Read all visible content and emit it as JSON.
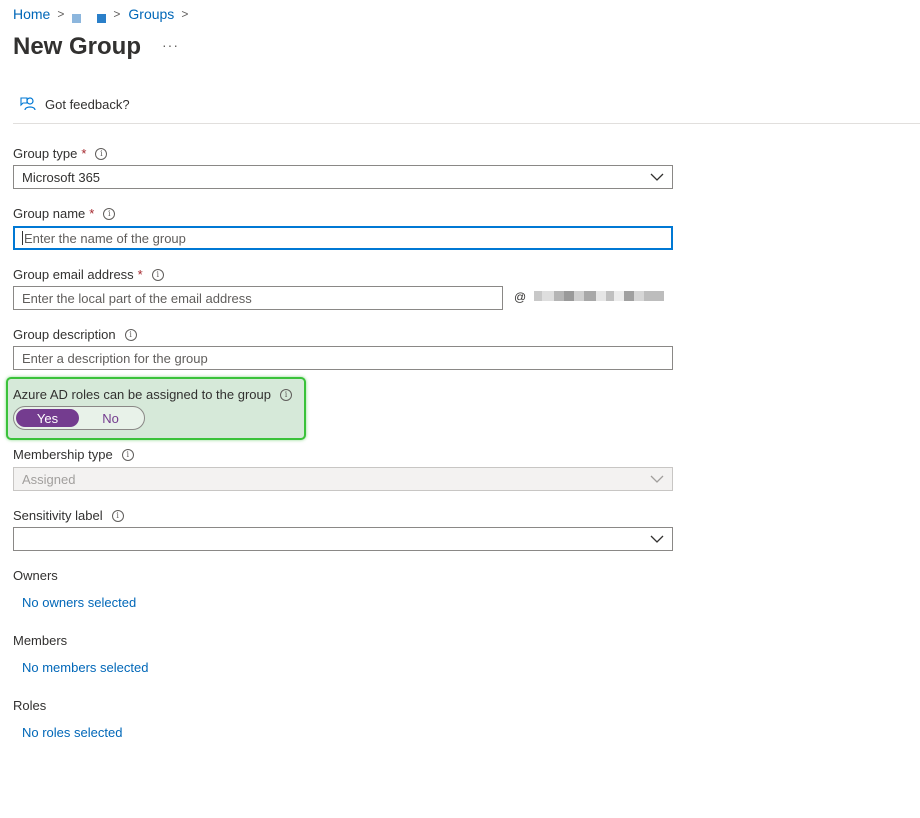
{
  "breadcrumb": {
    "home": "Home",
    "groups": "Groups"
  },
  "page": {
    "title": "New Group",
    "more": "···"
  },
  "feedback": {
    "label": "Got feedback?"
  },
  "group_type": {
    "label": "Group type",
    "required": "*",
    "value": "Microsoft 365"
  },
  "group_name": {
    "label": "Group name",
    "required": "*",
    "placeholder": "Enter the name of the group"
  },
  "group_email": {
    "label": "Group email address",
    "required": "*",
    "placeholder": "Enter the local part of the email address",
    "at": "@"
  },
  "group_description": {
    "label": "Group description",
    "placeholder": "Enter a description for the group"
  },
  "azure_roles": {
    "label": "Azure AD roles can be assigned to the group",
    "yes": "Yes",
    "no": "No",
    "selected": "Yes"
  },
  "membership_type": {
    "label": "Membership type",
    "value": "Assigned"
  },
  "sensitivity_label": {
    "label": "Sensitivity label",
    "value": ""
  },
  "owners": {
    "label": "Owners",
    "link": "No owners selected"
  },
  "members": {
    "label": "Members",
    "link": "No members selected"
  },
  "roles": {
    "label": "Roles",
    "link": "No roles selected"
  },
  "colors": {
    "link": "#0067b8",
    "toggle_selected": "#743c8f",
    "highlight_border": "#3ac23a",
    "focus_border": "#0078d4"
  }
}
